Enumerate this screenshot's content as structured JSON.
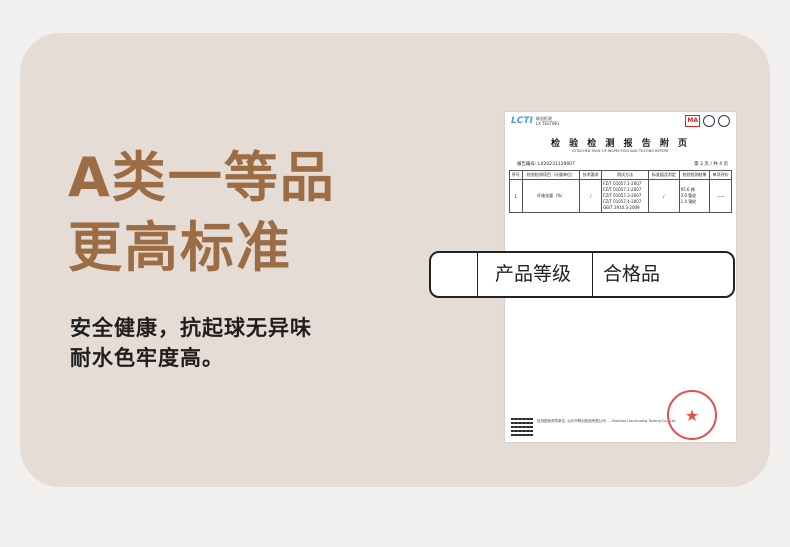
{
  "headline": {
    "line1": "A类一等品",
    "line2": "更高标准"
  },
  "subtitle": {
    "line1": "安全健康，抗起球无异味",
    "line2": "耐水色牢度高。"
  },
  "report": {
    "lab_name": "联创检测",
    "lab_name_en": "LX TESTING",
    "lab_mark": "LCTI",
    "cert_mark": "MA",
    "title": "检 验 检 测 报 告 附 页",
    "subtitle": "ATTACHED PAGE OF INSPECTION AND TESTING REPORT",
    "report_no": "报告编号: LX20231129007",
    "page": "第 2 页 / 共 4 页",
    "table_headers": [
      "序号",
      "检验检测项目（计量单位）",
      "技术要求",
      "测试方法",
      "标准值及判定",
      "检验检测结果",
      "单项评价"
    ],
    "row": {
      "no": "1",
      "item": "纤维含量（%）",
      "req": "/",
      "method": "FZ/T 01057.1-2007\nFZ/T 01057.2-2007\nFZ/T 01057.3-2007\nFZ/T 01057.4-2007\nGB/T 2910.3-2009",
      "std": "/",
      "result": "95.6 棉\n3.0 氨纶\n1.4 锦纶",
      "eval": "——"
    },
    "footer": "检测国家资质单位: 汕头市联创检测有限公司 … Shantou Lianchuang Testing Co., Ltd.",
    "stamp": "★"
  },
  "label": {
    "left": "产品等级",
    "right": "合格品"
  }
}
